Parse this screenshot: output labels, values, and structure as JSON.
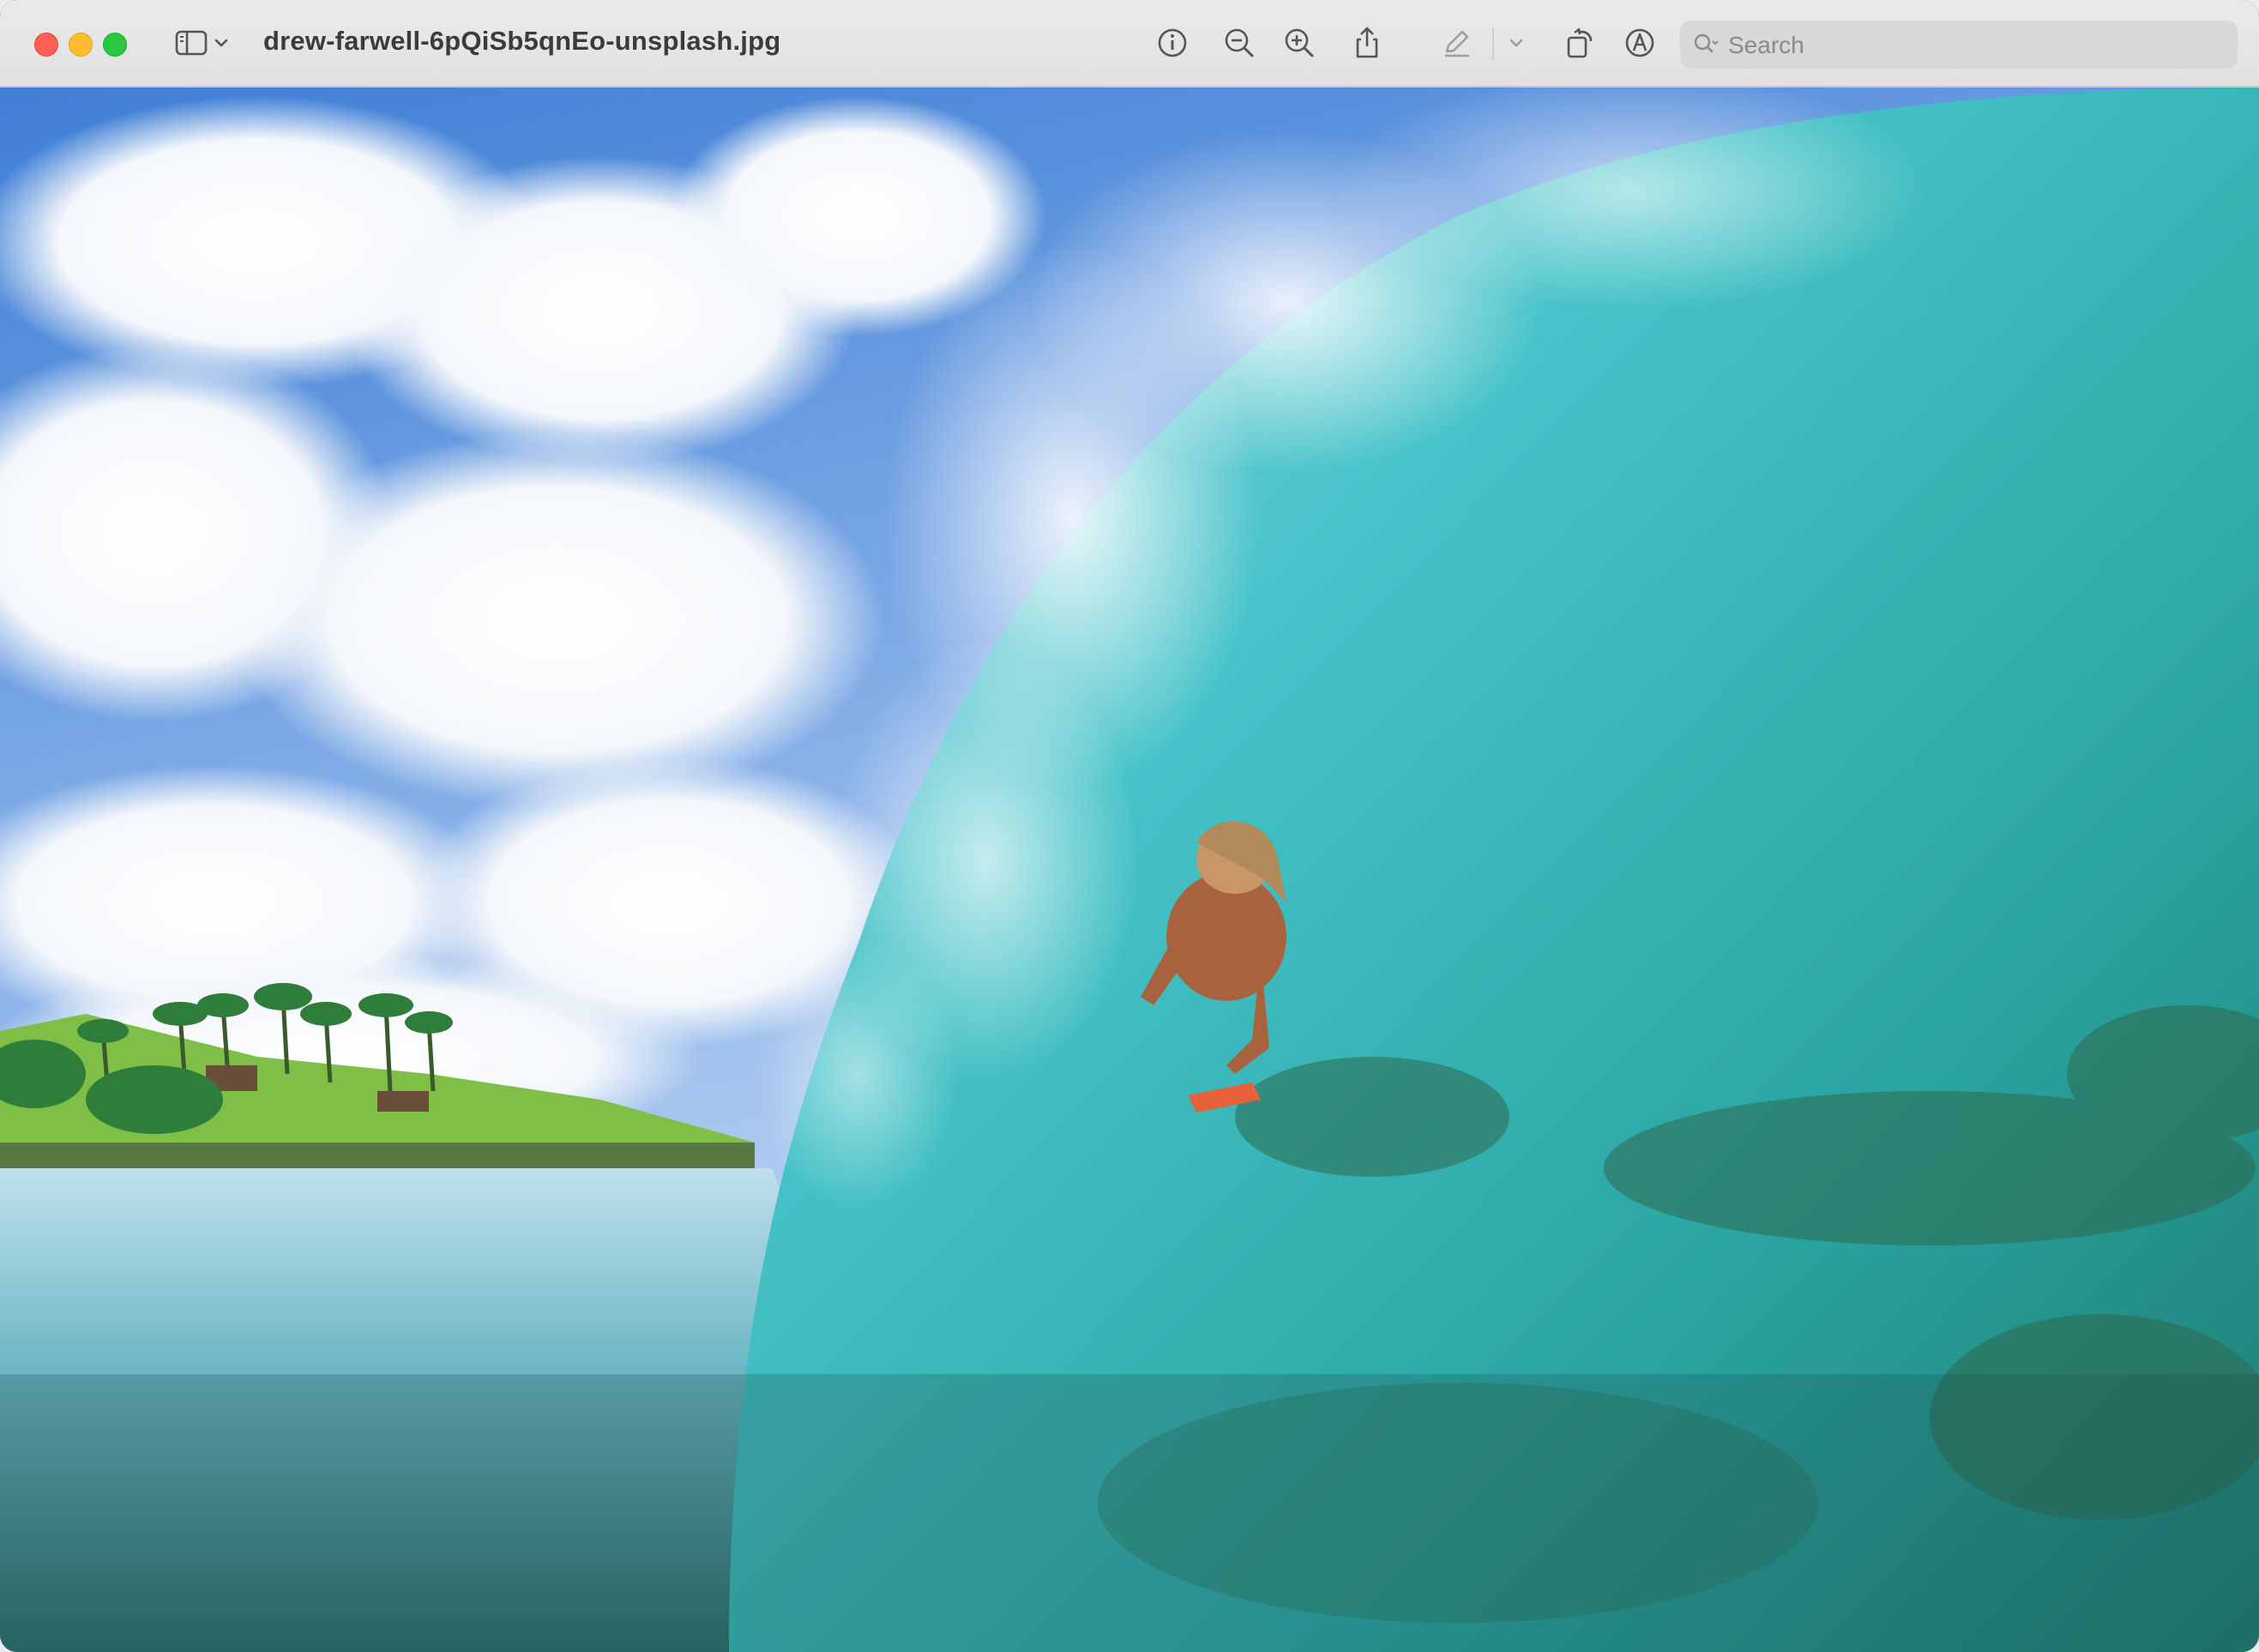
{
  "window": {
    "title": "drew-farwell-6pQiSb5qnEo-unsplash.jpg"
  },
  "toolbar": {
    "icons": [
      "sidebar-icon",
      "chevron-down-icon",
      "info-icon",
      "zoom-out-icon",
      "zoom-in-icon",
      "share-icon",
      "markup-pen-icon",
      "chevron-down-icon",
      "rotate-icon",
      "markup-icon"
    ]
  },
  "search": {
    "placeholder": "Search"
  },
  "colors": {
    "close": "#fe5f57",
    "minimize": "#febc2e",
    "maximize": "#28c840",
    "sky": "#4d86d8",
    "wave": "#3cc0c4",
    "deep_water": "#1f6a62"
  }
}
